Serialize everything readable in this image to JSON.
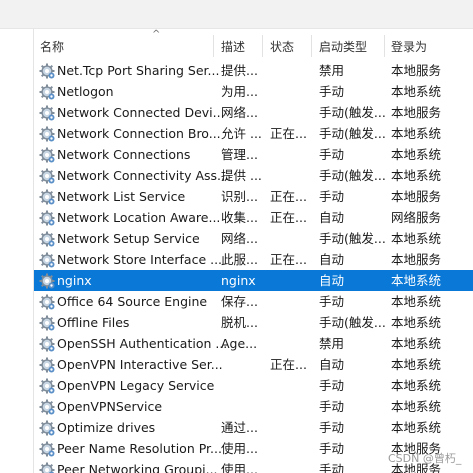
{
  "columns": {
    "name": "名称",
    "description": "描述",
    "status": "状态",
    "startup_type": "启动类型",
    "log_on_as": "登录为"
  },
  "rows": [
    {
      "name": "Net.Tcp Port Sharing Ser...",
      "description": "提供...",
      "status": "",
      "startup_type": "禁用",
      "log_on_as": "本地服务",
      "selected": false
    },
    {
      "name": "Netlogon",
      "description": "为用...",
      "status": "",
      "startup_type": "手动",
      "log_on_as": "本地系统",
      "selected": false
    },
    {
      "name": "Network Connected Devi...",
      "description": "网络...",
      "status": "",
      "startup_type": "手动(触发...",
      "log_on_as": "本地服务",
      "selected": false
    },
    {
      "name": "Network Connection Bro...",
      "description": "允许 ...",
      "status": "正在...",
      "startup_type": "手动(触发...",
      "log_on_as": "本地系统",
      "selected": false
    },
    {
      "name": "Network Connections",
      "description": "管理...",
      "status": "",
      "startup_type": "手动",
      "log_on_as": "本地系统",
      "selected": false
    },
    {
      "name": "Network Connectivity Ass...",
      "description": "提供 ...",
      "status": "",
      "startup_type": "手动(触发...",
      "log_on_as": "本地系统",
      "selected": false
    },
    {
      "name": "Network List Service",
      "description": "识别...",
      "status": "正在...",
      "startup_type": "手动",
      "log_on_as": "本地服务",
      "selected": false
    },
    {
      "name": "Network Location Aware...",
      "description": "收集...",
      "status": "正在...",
      "startup_type": "自动",
      "log_on_as": "网络服务",
      "selected": false
    },
    {
      "name": "Network Setup Service",
      "description": "网络...",
      "status": "",
      "startup_type": "手动(触发...",
      "log_on_as": "本地系统",
      "selected": false
    },
    {
      "name": "Network Store Interface ...",
      "description": "此服...",
      "status": "正在...",
      "startup_type": "自动",
      "log_on_as": "本地服务",
      "selected": false
    },
    {
      "name": "nginx",
      "description": "nginx",
      "status": "",
      "startup_type": "自动",
      "log_on_as": "本地系统",
      "selected": true
    },
    {
      "name": "Office 64 Source Engine",
      "description": "保存...",
      "status": "",
      "startup_type": "手动",
      "log_on_as": "本地系统",
      "selected": false
    },
    {
      "name": "Offline Files",
      "description": "脱机...",
      "status": "",
      "startup_type": "手动(触发...",
      "log_on_as": "本地系统",
      "selected": false
    },
    {
      "name": "OpenSSH Authentication ...",
      "description": "Age...",
      "status": "",
      "startup_type": "禁用",
      "log_on_as": "本地系统",
      "selected": false
    },
    {
      "name": "OpenVPN Interactive Ser...",
      "description": "",
      "status": "正在...",
      "startup_type": "自动",
      "log_on_as": "本地系统",
      "selected": false
    },
    {
      "name": "OpenVPN Legacy Service",
      "description": "",
      "status": "",
      "startup_type": "手动",
      "log_on_as": "本地系统",
      "selected": false
    },
    {
      "name": "OpenVPNService",
      "description": "",
      "status": "",
      "startup_type": "手动",
      "log_on_as": "本地系统",
      "selected": false
    },
    {
      "name": "Optimize drives",
      "description": "通过...",
      "status": "",
      "startup_type": "手动",
      "log_on_as": "本地系统",
      "selected": false
    },
    {
      "name": "Peer Name Resolution Pr...",
      "description": "使用...",
      "status": "",
      "startup_type": "手动",
      "log_on_as": "本地服务",
      "selected": false
    },
    {
      "name": "Peer Networking Groupi...",
      "description": "使用...",
      "status": "",
      "startup_type": "手动",
      "log_on_as": "本地服务",
      "selected": false
    }
  ],
  "icons": {
    "service": "gear-icon",
    "sort": "chevron-up-icon"
  },
  "colors": {
    "selection": "#0a78d7",
    "header_text": "#333333"
  },
  "watermark": "CSDN @曾朽_"
}
